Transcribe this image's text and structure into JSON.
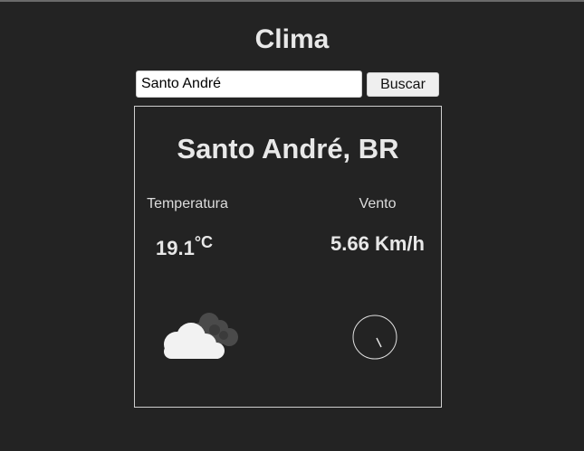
{
  "page": {
    "title": "Clima"
  },
  "search": {
    "value": "Santo André",
    "button_label": "Buscar"
  },
  "weather": {
    "city": "Santo André, BR",
    "temperature_label": "Temperatura",
    "temperature_value": "19.1",
    "temperature_unit": "°C",
    "wind_label": "Vento",
    "wind_value": "5.66 Km/h",
    "condition_icon": "cloud-icon",
    "wind_direction_icon": "wind-direction-gauge-icon"
  },
  "colors": {
    "background": "#232323",
    "text": "#e8e8e8",
    "border": "#cfcfcf"
  }
}
